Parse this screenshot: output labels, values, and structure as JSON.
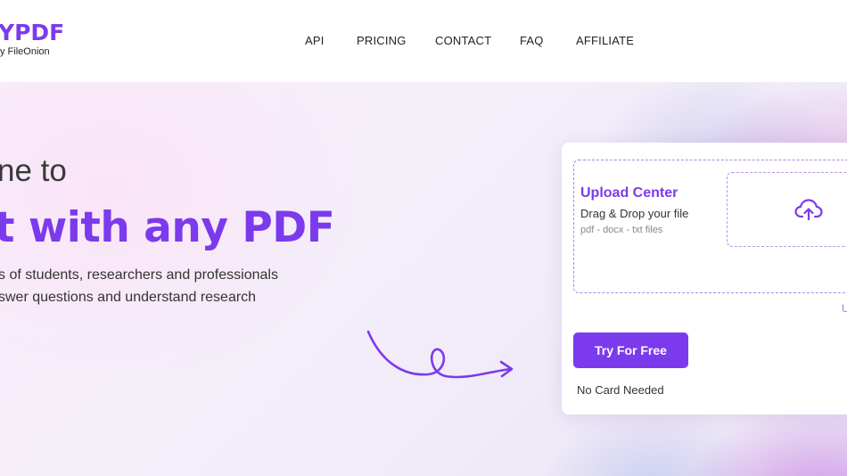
{
  "header": {
    "logo_title": "YPDF",
    "logo_sub": "y FileOnion",
    "nav": [
      {
        "label": "API"
      },
      {
        "label": "PRICING"
      },
      {
        "label": "CONTACT"
      },
      {
        "label": "FAQ"
      },
      {
        "label": "AFFILIATE"
      }
    ]
  },
  "hero": {
    "line1": "ne to",
    "line2": "t with any PDF",
    "desc_line1": "s of students, researchers and professionals",
    "desc_line2": "swer questions and understand research"
  },
  "upload_card": {
    "title": "Upload Center",
    "drag_text": "Drag & Drop your file",
    "types": "pdf - docx - txt files",
    "side_link": "U",
    "cta_label": "Try For Free",
    "note": "No Card Needed"
  },
  "colors": {
    "accent": "#7c3aed",
    "text": "#222222",
    "dashed_border": "#a78be4"
  },
  "icons": {
    "upload": "cloud-upload-icon",
    "decor_arrow": "curly-arrow-icon"
  }
}
